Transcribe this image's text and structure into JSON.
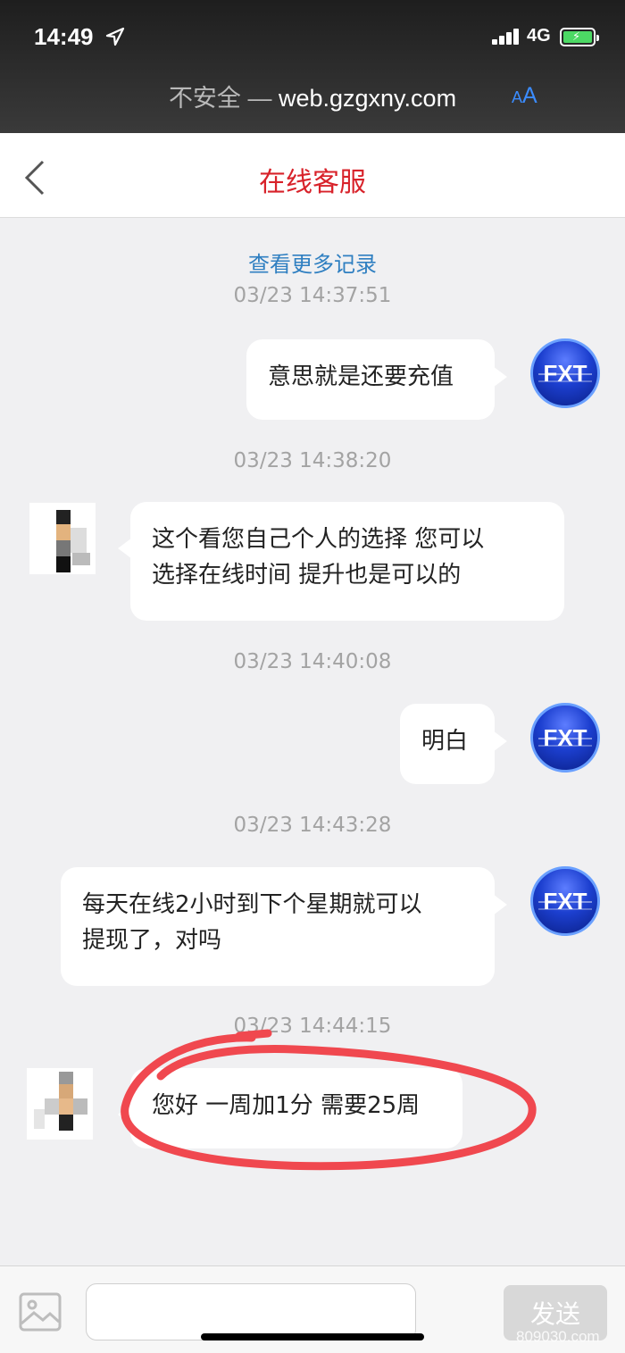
{
  "status_bar": {
    "time": "14:49",
    "network": "4G"
  },
  "browser": {
    "insecure_label": "不安全 —",
    "host": "web.gzgxny.com",
    "text_size_label_small": "A",
    "text_size_label_large": "A"
  },
  "header": {
    "title": "在线客服"
  },
  "chat": {
    "load_more": "查看更多记录",
    "messages": [
      {
        "time": "03/23 14:37:51",
        "sender": "user",
        "avatar_text": "FXT",
        "lines": [
          "意思就是还要充值"
        ]
      },
      {
        "time": "03/23 14:38:20",
        "sender": "agent",
        "lines": [
          "这个看您自己个人的选择 您可以",
          "选择在线时间 提升也是可以的"
        ]
      },
      {
        "time": "03/23 14:40:08",
        "sender": "user",
        "avatar_text": "FXT",
        "lines": [
          "明白"
        ]
      },
      {
        "time": "03/23 14:43:28",
        "sender": "user",
        "avatar_text": "FXT",
        "lines": [
          "每天在线2小时到下个星期就可以",
          "提现了，对吗"
        ]
      },
      {
        "time": "03/23 14:44:15",
        "sender": "agent",
        "lines": [
          "您好 一周加1分 需要25周"
        ]
      }
    ]
  },
  "input_bar": {
    "message_value": "",
    "send_label": "发送"
  },
  "watermark": "809030.com",
  "colors": {
    "title_red": "#d8222a",
    "link_blue": "#2f7fc1",
    "annotation_red": "#f0484f"
  }
}
